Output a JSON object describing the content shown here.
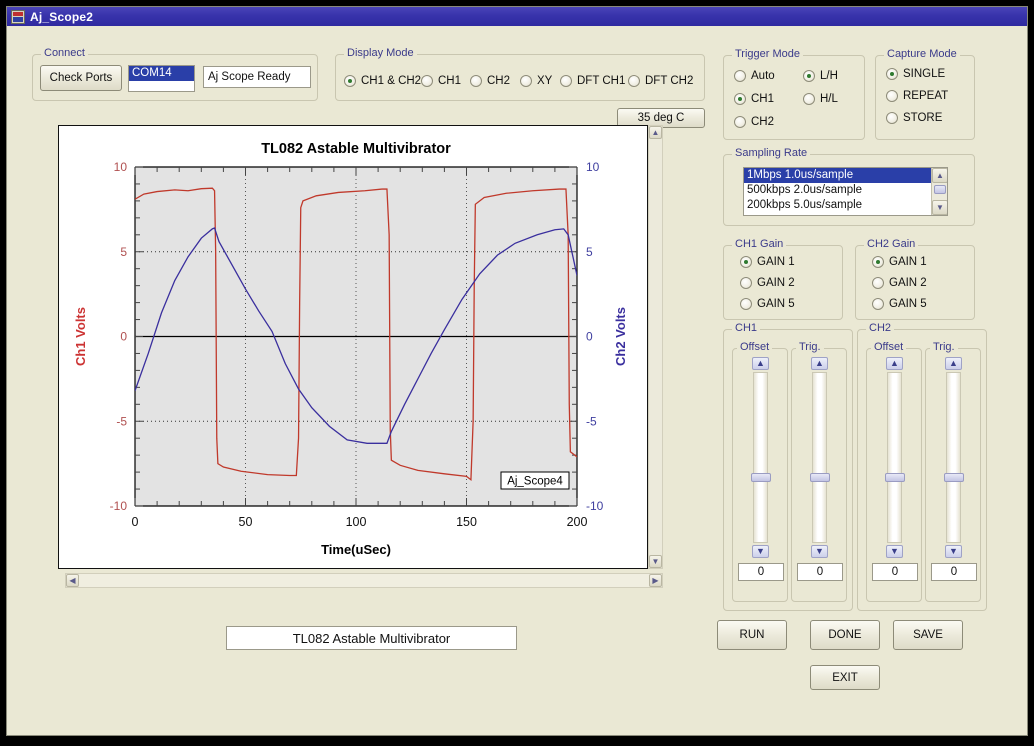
{
  "window": {
    "title": "Aj_Scope2",
    "icon": "scope-app-icon",
    "bg_color": "#eae8d4",
    "titlebar_color": "#3833ab"
  },
  "connect": {
    "legend": "Connect",
    "check_ports_label": "Check Ports",
    "port_list": [
      {
        "label": "COM14",
        "selected": true
      }
    ],
    "status_text": "Aj Scope Ready"
  },
  "display_mode": {
    "legend": "Display Mode",
    "options": [
      {
        "label": "CH1 & CH2",
        "selected": true
      },
      {
        "label": "CH1",
        "selected": false
      },
      {
        "label": "CH2",
        "selected": false
      },
      {
        "label": "XY",
        "selected": false
      },
      {
        "label": "DFT CH1",
        "selected": false
      },
      {
        "label": "DFT CH2",
        "selected": false
      }
    ]
  },
  "temperature_button": {
    "label": "35 deg C"
  },
  "trigger_mode": {
    "legend": "Trigger Mode",
    "options": [
      {
        "label": "Auto",
        "selected": false
      },
      {
        "label": "L/H",
        "selected": true
      },
      {
        "label": "CH1",
        "selected": true
      },
      {
        "label": "H/L",
        "selected": false
      },
      {
        "label": "CH2",
        "selected": false
      }
    ]
  },
  "capture_mode": {
    "legend": "Capture Mode",
    "options": [
      {
        "label": "SINGLE",
        "selected": true
      },
      {
        "label": "REPEAT",
        "selected": false
      },
      {
        "label": "STORE",
        "selected": false
      }
    ]
  },
  "sampling_rate": {
    "legend": "Sampling Rate",
    "items": [
      {
        "label": "1Mbps  1.0us/sample",
        "selected": true
      },
      {
        "label": "500kbps 2.0us/sample",
        "selected": false
      },
      {
        "label": "200kbps 5.0us/sample",
        "selected": false
      }
    ]
  },
  "ch1_gain": {
    "legend": "CH1 Gain",
    "options": [
      {
        "label": "GAIN 1",
        "selected": true
      },
      {
        "label": "GAIN 2",
        "selected": false
      },
      {
        "label": "GAIN 5",
        "selected": false
      }
    ]
  },
  "ch2_gain": {
    "legend": "CH2 Gain",
    "options": [
      {
        "label": "GAIN 1",
        "selected": true
      },
      {
        "label": "GAIN 2",
        "selected": false
      },
      {
        "label": "GAIN 5",
        "selected": false
      }
    ]
  },
  "ch1_controls": {
    "legend": "CH1",
    "offset": {
      "legend": "Offset",
      "value": "0"
    },
    "trig": {
      "legend": "Trig.",
      "value": "0"
    }
  },
  "ch2_controls": {
    "legend": "CH2",
    "offset": {
      "legend": "Offset",
      "value": "0"
    },
    "trig": {
      "legend": "Trig.",
      "value": "0"
    }
  },
  "action_buttons": {
    "run": "RUN",
    "done": "DONE",
    "save": "SAVE",
    "exit": "EXIT"
  },
  "caption_field": {
    "value": "TL082 Astable Multivibrator"
  },
  "chart_data": {
    "type": "line",
    "title": "TL082 Astable Multivibrator",
    "xlabel": "Time(uSec)",
    "ylabel_left": "Ch1 Volts",
    "ylabel_right": "Ch2 Volts",
    "ylabel_left_color": "#cc3333",
    "ylabel_right_color": "#3a2f9e",
    "xlim": [
      0,
      200
    ],
    "ylim": [
      -10,
      10
    ],
    "xticks": [
      0,
      50,
      100,
      150,
      200
    ],
    "yticks": [
      -10,
      -5,
      0,
      5,
      10
    ],
    "grid": "dotted",
    "plot_bg": "#e3e3e3",
    "annotation": "Aj_Scope4",
    "series": [
      {
        "name": "Ch1 Volts",
        "color": "#c0392b",
        "axis": "left",
        "description": "Square wave, op-amp output, ~78us period",
        "points": [
          [
            0,
            8.1
          ],
          [
            4,
            8.4
          ],
          [
            10,
            8.55
          ],
          [
            18,
            8.65
          ],
          [
            24,
            8.6
          ],
          [
            30,
            8.72
          ],
          [
            35,
            8.75
          ],
          [
            36,
            8.6
          ],
          [
            36.5,
            5.0
          ],
          [
            37,
            -6.0
          ],
          [
            37.5,
            -7.5
          ],
          [
            40,
            -7.7
          ],
          [
            48,
            -7.95
          ],
          [
            60,
            -8.15
          ],
          [
            70,
            -8.2
          ],
          [
            73,
            -8.2
          ],
          [
            74,
            -6.0
          ],
          [
            74.5,
            2.0
          ],
          [
            75,
            7.6
          ],
          [
            76,
            8.0
          ],
          [
            82,
            8.3
          ],
          [
            92,
            8.5
          ],
          [
            104,
            8.6
          ],
          [
            112,
            8.7
          ],
          [
            114,
            8.7
          ],
          [
            115,
            6.0
          ],
          [
            115.5,
            -5.5
          ],
          [
            116,
            -7.3
          ],
          [
            120,
            -7.6
          ],
          [
            128,
            -7.9
          ],
          [
            140,
            -8.1
          ],
          [
            150,
            -8.25
          ],
          [
            152,
            -8.45
          ],
          [
            153,
            -5.0
          ],
          [
            153.5,
            3.0
          ],
          [
            154,
            7.8
          ],
          [
            158,
            8.2
          ],
          [
            168,
            8.45
          ],
          [
            180,
            8.6
          ],
          [
            192,
            8.7
          ],
          [
            195,
            8.7
          ],
          [
            196,
            6.0
          ],
          [
            196.5,
            -4.0
          ],
          [
            197,
            -6.8
          ],
          [
            200,
            -7.1
          ]
        ]
      },
      {
        "name": "Ch2 Volts",
        "color": "#3a2f9e",
        "axis": "right",
        "description": "Triangle / capacitor charge-discharge waveform",
        "points": [
          [
            0,
            -3.2
          ],
          [
            6,
            -1.0
          ],
          [
            12,
            1.4
          ],
          [
            18,
            3.3
          ],
          [
            24,
            4.7
          ],
          [
            30,
            5.8
          ],
          [
            35,
            6.35
          ],
          [
            36,
            6.4
          ],
          [
            38,
            5.6
          ],
          [
            44,
            4.2
          ],
          [
            50,
            2.8
          ],
          [
            56,
            1.5
          ],
          [
            62,
            0.3
          ],
          [
            68,
            -1.6
          ],
          [
            74,
            -3.1
          ],
          [
            80,
            -4.2
          ],
          [
            88,
            -5.3
          ],
          [
            96,
            -6.1
          ],
          [
            105,
            -6.3
          ],
          [
            110,
            -6.3
          ],
          [
            114,
            -6.3
          ],
          [
            116,
            -5.6
          ],
          [
            122,
            -4.0
          ],
          [
            128,
            -2.5
          ],
          [
            134,
            -1.0
          ],
          [
            140,
            0.4
          ],
          [
            148,
            2.2
          ],
          [
            156,
            3.7
          ],
          [
            164,
            4.8
          ],
          [
            172,
            5.5
          ],
          [
            182,
            6.0
          ],
          [
            190,
            6.3
          ],
          [
            194,
            6.35
          ],
          [
            196,
            6.0
          ],
          [
            198,
            4.8
          ],
          [
            200,
            3.6
          ]
        ]
      }
    ]
  }
}
